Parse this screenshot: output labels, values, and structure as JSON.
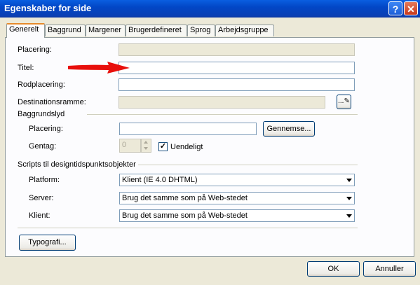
{
  "window": {
    "title": "Egenskaber for side",
    "help_glyph": "?",
    "close_glyph": "✕"
  },
  "tabs": [
    "Generelt",
    "Baggrund",
    "Margener",
    "Brugerdefineret",
    "Sprog",
    "Arbejdsgruppe"
  ],
  "general": {
    "placering_label": "Placering:",
    "titel_label": "Titel:",
    "rodplacering_label": "Rodplacering:",
    "destination_label": "Destinationsramme:",
    "destination_button_glyph": "..."
  },
  "background_sound": {
    "heading": "Baggrundslyd",
    "placering_label": "Placering:",
    "browse_button": "Gennemse...",
    "repeat_label": "Gentag:",
    "repeat_value": "0",
    "infinite_label": "Uendeligt",
    "infinite_checked": true
  },
  "scripts": {
    "heading": "Scripts til designtidspunktsobjekter",
    "platform_label": "Platform:",
    "platform_value": "Klient (IE 4.0 DHTML)",
    "server_label": "Server:",
    "server_value": "Brug det samme som på Web-stedet",
    "client_label": "Klient:",
    "client_value": "Brug det samme som på Web-stedet"
  },
  "style_button": "Typografi...",
  "ok_button": "OK",
  "cancel_button": "Annuller",
  "colors": {
    "title_bar": "#0a46c8",
    "dialog_bg": "#ece9d8",
    "annotation_arrow": "#e8100c"
  }
}
